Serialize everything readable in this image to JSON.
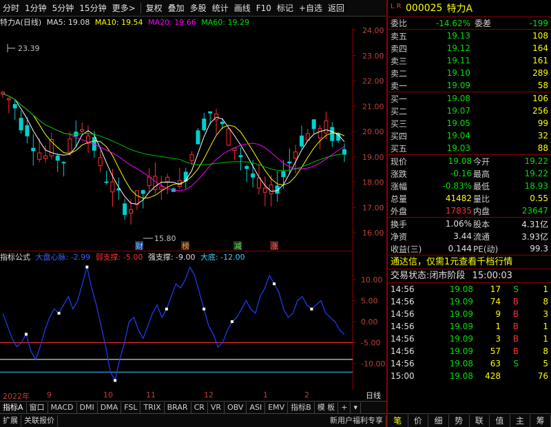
{
  "toolbar": {
    "items": [
      "分时",
      "1分钟",
      "5分钟",
      "15分钟",
      "更多>"
    ],
    "items2": [
      "复权",
      "叠加",
      "多股",
      "统计",
      "画线",
      "F10",
      "标记",
      "+自选",
      "返回"
    ]
  },
  "chart_title": {
    "name": "特力A(日线)",
    "ma5": "MA5: 19.08",
    "ma10": "MA10: 19.54",
    "ma20": "MA20: 19.66",
    "ma60": "MA60: 19.29"
  },
  "price_axis": [
    "24.00",
    "23.00",
    "22.00",
    "21.00",
    "20.00",
    "19.00",
    "18.00",
    "17.00",
    "16.00"
  ],
  "annotations": {
    "high": "23.39",
    "low": "15.80"
  },
  "event_labels": [
    "财",
    "榜",
    "减",
    "涨"
  ],
  "indicator_title": {
    "name": "指标公式",
    "l1": "大盘心脉: -2.99",
    "l2": "弱支撑: -5.00",
    "l3": "强支撑: -9.00",
    "l4": "大底: -12.00"
  },
  "ind_axis": [
    "10.00",
    "5.00",
    "0.00",
    "-5.00",
    "-10.00"
  ],
  "date_axis": [
    "2022年",
    "9",
    "10",
    "11",
    "12",
    "1",
    "2"
  ],
  "day_button": "日线",
  "ind_tabs": [
    "指标A",
    "窗口",
    "MACD",
    "DMI",
    "DMA",
    "FSL",
    "TRIX",
    "BRAR",
    "CR",
    "VR",
    "OBV",
    "ASI",
    "EMV",
    "指标B",
    "模 板",
    "+",
    "▾"
  ],
  "bottom_bar": [
    "扩展",
    "关联报价"
  ],
  "bottom_right": "新用户福利专享",
  "stock": {
    "code": "000025",
    "name": "特力A",
    "mark": "L R"
  },
  "weibi": {
    "label1": "委比",
    "v1": "-14.62%",
    "label2": "委差",
    "v2": "-199"
  },
  "sell": [
    {
      "label": "卖五",
      "price": "19.13",
      "vol": "108"
    },
    {
      "label": "卖四",
      "price": "19.12",
      "vol": "164"
    },
    {
      "label": "卖三",
      "price": "19.11",
      "vol": "161"
    },
    {
      "label": "卖二",
      "price": "19.10",
      "vol": "289"
    },
    {
      "label": "卖一",
      "price": "19.09",
      "vol": "58"
    }
  ],
  "buy": [
    {
      "label": "买一",
      "price": "19.08",
      "vol": "106"
    },
    {
      "label": "买二",
      "price": "19.07",
      "vol": "256"
    },
    {
      "label": "买三",
      "price": "19.05",
      "vol": "99"
    },
    {
      "label": "买四",
      "price": "19.04",
      "vol": "32"
    },
    {
      "label": "买五",
      "price": "19.03",
      "vol": "88"
    }
  ],
  "quote": [
    {
      "l1": "现价",
      "v1": "19.08",
      "c1": "green",
      "l2": "今开",
      "v2": "19.22",
      "c2": "green"
    },
    {
      "l1": "涨跌",
      "v1": "-0.16",
      "c1": "green",
      "l2": "最高",
      "v2": "19.22",
      "c2": "green"
    },
    {
      "l1": "涨幅",
      "v1": "-0.83%",
      "c1": "green",
      "l2": "最低",
      "v2": "18.93",
      "c2": "green"
    },
    {
      "l1": "总量",
      "v1": "41482",
      "c1": "yellow",
      "l2": "量比",
      "v2": "0.55",
      "c2": "yellow"
    },
    {
      "l1": "外盘",
      "v1": "17835",
      "c1": "red",
      "l2": "内盘",
      "v2": "23647",
      "c2": "green"
    }
  ],
  "quote2": [
    {
      "l1": "换手",
      "v1": "1.06%",
      "l2": "股本",
      "v2": "4.31亿"
    },
    {
      "l1": "净资",
      "v1": "3.44",
      "l2": "流通",
      "v2": "3.93亿"
    },
    {
      "l1": "收益(三)",
      "v1": "0.144",
      "l2": "PE(动)",
      "v2": "99.3"
    }
  ],
  "promo": "通达信，仅需1元查看千档行情",
  "status": {
    "label": "交易状态:",
    "value": "闭市阶段",
    "time": "15:00:03"
  },
  "ticks": [
    {
      "t": "14:56",
      "p": "19.08",
      "v": "17",
      "d": "S",
      "n": "1"
    },
    {
      "t": "14:56",
      "p": "19.09",
      "v": "74",
      "d": "B",
      "n": "8"
    },
    {
      "t": "14:56",
      "p": "19.09",
      "v": "9",
      "d": "B",
      "n": "3"
    },
    {
      "t": "14:56",
      "p": "19.09",
      "v": "1",
      "d": "B",
      "n": "1"
    },
    {
      "t": "14:56",
      "p": "19.09",
      "v": "3",
      "d": "B",
      "n": "1"
    },
    {
      "t": "14:56",
      "p": "19.09",
      "v": "57",
      "d": "B",
      "n": "8"
    },
    {
      "t": "14:56",
      "p": "19.08",
      "v": "63",
      "d": "S",
      "n": "5"
    },
    {
      "t": "15:00",
      "p": "19.08",
      "v": "428",
      "d": "",
      "n": "76"
    }
  ],
  "rp_tabs": [
    "笔",
    "价",
    "细",
    "势",
    "联",
    "值",
    "主",
    "筹"
  ]
}
